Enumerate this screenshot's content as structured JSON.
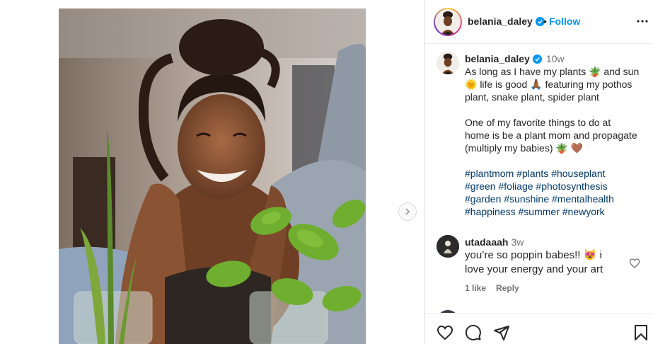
{
  "post": {
    "username": "belania_daley",
    "follow_label": "Follow",
    "separator": "•",
    "caption_time": "10w",
    "caption_lines": [
      "As long as I have my plants 🪴 and sun",
      "🌞 life is good 🙏🏾 featuring my pothos",
      "plant, snake plant, spider plant",
      "One of my favorite things to do at",
      "home is be a plant mom and propagate",
      "(multiply my babies) 🪴 🤎"
    ],
    "hashtag_lines": [
      [
        "#plantmom",
        "#plants",
        "#houseplant"
      ],
      [
        "#green",
        "#foliage",
        "#photosynthesis"
      ],
      [
        "#garden",
        "#sunshine",
        "#mentalhealth"
      ],
      [
        "#happiness",
        "#summer",
        "#newyork"
      ]
    ]
  },
  "comment": {
    "username": "utadaaah",
    "time": "3w",
    "text_lines": [
      "you’re so poppin babes!! 😻 i",
      "love your energy and your art"
    ],
    "likes": "1 like",
    "reply": "Reply"
  },
  "icons": {
    "verified": "verified-badge-icon",
    "more": "more-options-icon",
    "next": "chevron-right-icon",
    "like": "heart-icon",
    "comment": "comment-icon",
    "share": "send-icon",
    "save": "bookmark-icon"
  },
  "colors": {
    "link": "#0095f6",
    "hashtag": "#00376b",
    "muted": "#737373"
  }
}
